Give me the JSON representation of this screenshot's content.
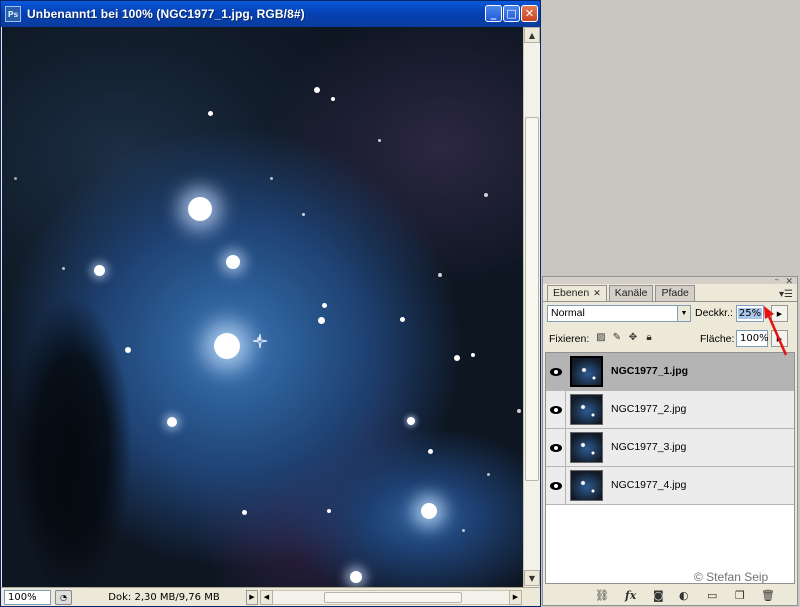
{
  "window": {
    "title": "Unbenannt1 bei 100% (NGC1977_1.jpg, RGB/8#)",
    "app_icon": "Ps"
  },
  "status": {
    "zoom": "100%",
    "document_info": "Dok: 2,30 MB/9,76 MB"
  },
  "layers_panel": {
    "tabs": [
      {
        "label": "Ebenen",
        "active": true
      },
      {
        "label": "Kanäle",
        "active": false
      },
      {
        "label": "Pfade",
        "active": false
      }
    ],
    "blend_mode": "Normal",
    "opacity_label": "Deckkr.:",
    "opacity": "25%",
    "lock_label": "Fixieren:",
    "fill_label": "Fläche:",
    "fill": "100%",
    "layers": [
      {
        "name": "NGC1977_1.jpg",
        "visible": true,
        "selected": true
      },
      {
        "name": "NGC1977_2.jpg",
        "visible": true,
        "selected": false
      },
      {
        "name": "NGC1977_3.jpg",
        "visible": true,
        "selected": false
      },
      {
        "name": "NGC1977_4.jpg",
        "visible": true,
        "selected": false
      }
    ],
    "bottom_icons": [
      "link-icon",
      "fx-icon",
      "mask-icon",
      "adjustment-icon",
      "folder-icon",
      "new-layer-icon",
      "trash-icon"
    ],
    "bottom_labels": {
      "fx": "fx"
    }
  },
  "watermark": "© Stefan Seip",
  "colors": {
    "title_bar": "#0a4fc8",
    "annotation_arrow": "#e81010"
  }
}
